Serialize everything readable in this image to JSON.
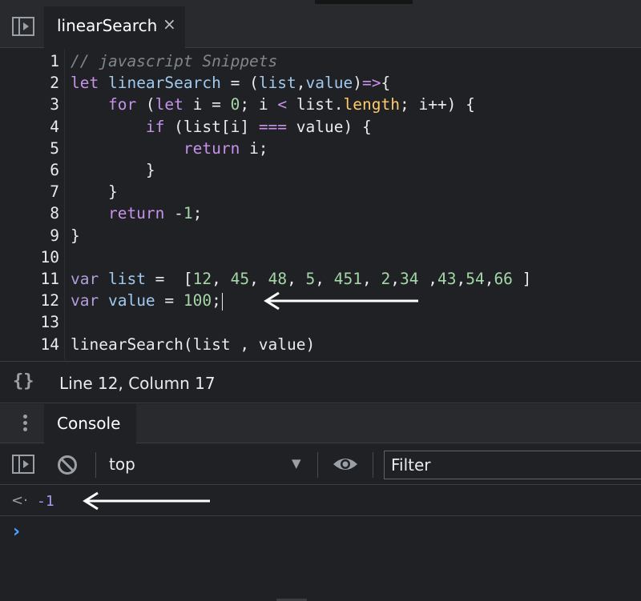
{
  "tab": {
    "title": "linearSearch",
    "close_glyph": "×"
  },
  "editor": {
    "lines": [
      {
        "n": "1",
        "tokens": [
          {
            "t": "// javascript Snippets",
            "c": "cmt"
          }
        ]
      },
      {
        "n": "2",
        "tokens": [
          {
            "t": "let ",
            "c": "kw"
          },
          {
            "t": "linearSearch",
            "c": "id"
          },
          {
            "t": " = (",
            "c": "plain"
          },
          {
            "t": "list",
            "c": "id"
          },
          {
            "t": ",",
            "c": "plain"
          },
          {
            "t": "value",
            "c": "id"
          },
          {
            "t": ")",
            "c": "plain"
          },
          {
            "t": "=>",
            "c": "kw"
          },
          {
            "t": "{",
            "c": "plain"
          }
        ]
      },
      {
        "n": "3",
        "tokens": [
          {
            "t": "    for ",
            "c": "kw"
          },
          {
            "t": "(",
            "c": "plain"
          },
          {
            "t": "let ",
            "c": "kw"
          },
          {
            "t": "i = ",
            "c": "plain"
          },
          {
            "t": "0",
            "c": "num"
          },
          {
            "t": "; i ",
            "c": "plain"
          },
          {
            "t": "<",
            "c": "kw"
          },
          {
            "t": " list.",
            "c": "plain"
          },
          {
            "t": "length",
            "c": "prop"
          },
          {
            "t": "; i++) {",
            "c": "plain"
          }
        ]
      },
      {
        "n": "4",
        "tokens": [
          {
            "t": "        if ",
            "c": "kw"
          },
          {
            "t": "(list[i] ",
            "c": "plain"
          },
          {
            "t": "===",
            "c": "kw"
          },
          {
            "t": " value) {",
            "c": "plain"
          }
        ]
      },
      {
        "n": "5",
        "tokens": [
          {
            "t": "            return ",
            "c": "kw"
          },
          {
            "t": "i;",
            "c": "plain"
          }
        ]
      },
      {
        "n": "6",
        "tokens": [
          {
            "t": "        }",
            "c": "plain"
          }
        ]
      },
      {
        "n": "7",
        "tokens": [
          {
            "t": "    }",
            "c": "plain"
          }
        ]
      },
      {
        "n": "8",
        "tokens": [
          {
            "t": "    return ",
            "c": "kw"
          },
          {
            "t": "-",
            "c": "plain"
          },
          {
            "t": "1",
            "c": "num"
          },
          {
            "t": ";",
            "c": "plain"
          }
        ]
      },
      {
        "n": "9",
        "tokens": [
          {
            "t": "}",
            "c": "plain"
          }
        ]
      },
      {
        "n": "10",
        "tokens": []
      },
      {
        "n": "11",
        "tokens": [
          {
            "t": "var ",
            "c": "kw2"
          },
          {
            "t": "list",
            "c": "id"
          },
          {
            "t": " =  [",
            "c": "plain"
          },
          {
            "t": "12",
            "c": "num"
          },
          {
            "t": ", ",
            "c": "plain"
          },
          {
            "t": "45",
            "c": "num"
          },
          {
            "t": ", ",
            "c": "plain"
          },
          {
            "t": "48",
            "c": "num"
          },
          {
            "t": ", ",
            "c": "plain"
          },
          {
            "t": "5",
            "c": "num"
          },
          {
            "t": ", ",
            "c": "plain"
          },
          {
            "t": "451",
            "c": "num"
          },
          {
            "t": ", ",
            "c": "plain"
          },
          {
            "t": "2",
            "c": "num"
          },
          {
            "t": ",",
            "c": "plain"
          },
          {
            "t": "34",
            "c": "num"
          },
          {
            "t": " ,",
            "c": "plain"
          },
          {
            "t": "43",
            "c": "num"
          },
          {
            "t": ",",
            "c": "plain"
          },
          {
            "t": "54",
            "c": "num"
          },
          {
            "t": ",",
            "c": "plain"
          },
          {
            "t": "66",
            "c": "num"
          },
          {
            "t": " ]",
            "c": "plain"
          }
        ]
      },
      {
        "n": "12",
        "tokens": [
          {
            "t": "var ",
            "c": "kw2"
          },
          {
            "t": "value",
            "c": "id"
          },
          {
            "t": " = ",
            "c": "plain"
          },
          {
            "t": "100",
            "c": "num"
          },
          {
            "t": ";",
            "c": "plain"
          }
        ],
        "cursor": true
      },
      {
        "n": "13",
        "tokens": []
      },
      {
        "n": "14",
        "tokens": [
          {
            "t": "linearSearch(list , value)",
            "c": "plain"
          }
        ]
      }
    ]
  },
  "status": {
    "position": "Line 12, Column 17",
    "braces": "{}"
  },
  "drawer": {
    "tab_label": "Console"
  },
  "console": {
    "context": "top",
    "filter_placeholder": "Filter",
    "result_glyph": "<·",
    "result_value": "-1",
    "prompt_glyph": "›"
  },
  "colors": {
    "background": "#202124",
    "toolbar": "#292a2d",
    "result": "#a49cf0",
    "prompt": "#4fa3ff"
  }
}
